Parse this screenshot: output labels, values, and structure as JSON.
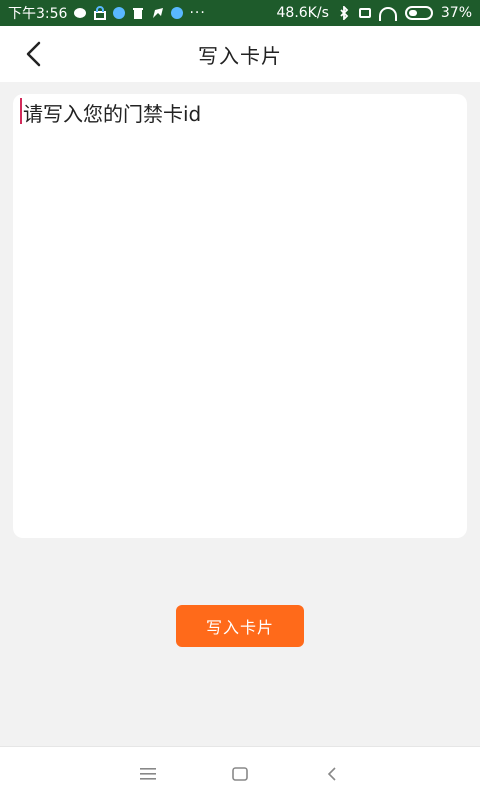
{
  "status": {
    "time": "下午3:56",
    "net_speed": "48.6K/s",
    "battery_pct": "37%",
    "dots": "···"
  },
  "header": {
    "title": "写入卡片"
  },
  "form": {
    "placeholder": "请写入您的门禁卡id",
    "value": ""
  },
  "button": {
    "label": "写入卡片"
  },
  "icons": {
    "back": "back-arrow-icon",
    "menu": "menu-icon",
    "home": "home-icon",
    "nav_back": "nav-back-icon"
  },
  "colors": {
    "status_bar": "#1e5b2b",
    "accent": "#ff6a1a",
    "cursor": "#d22b5a"
  }
}
